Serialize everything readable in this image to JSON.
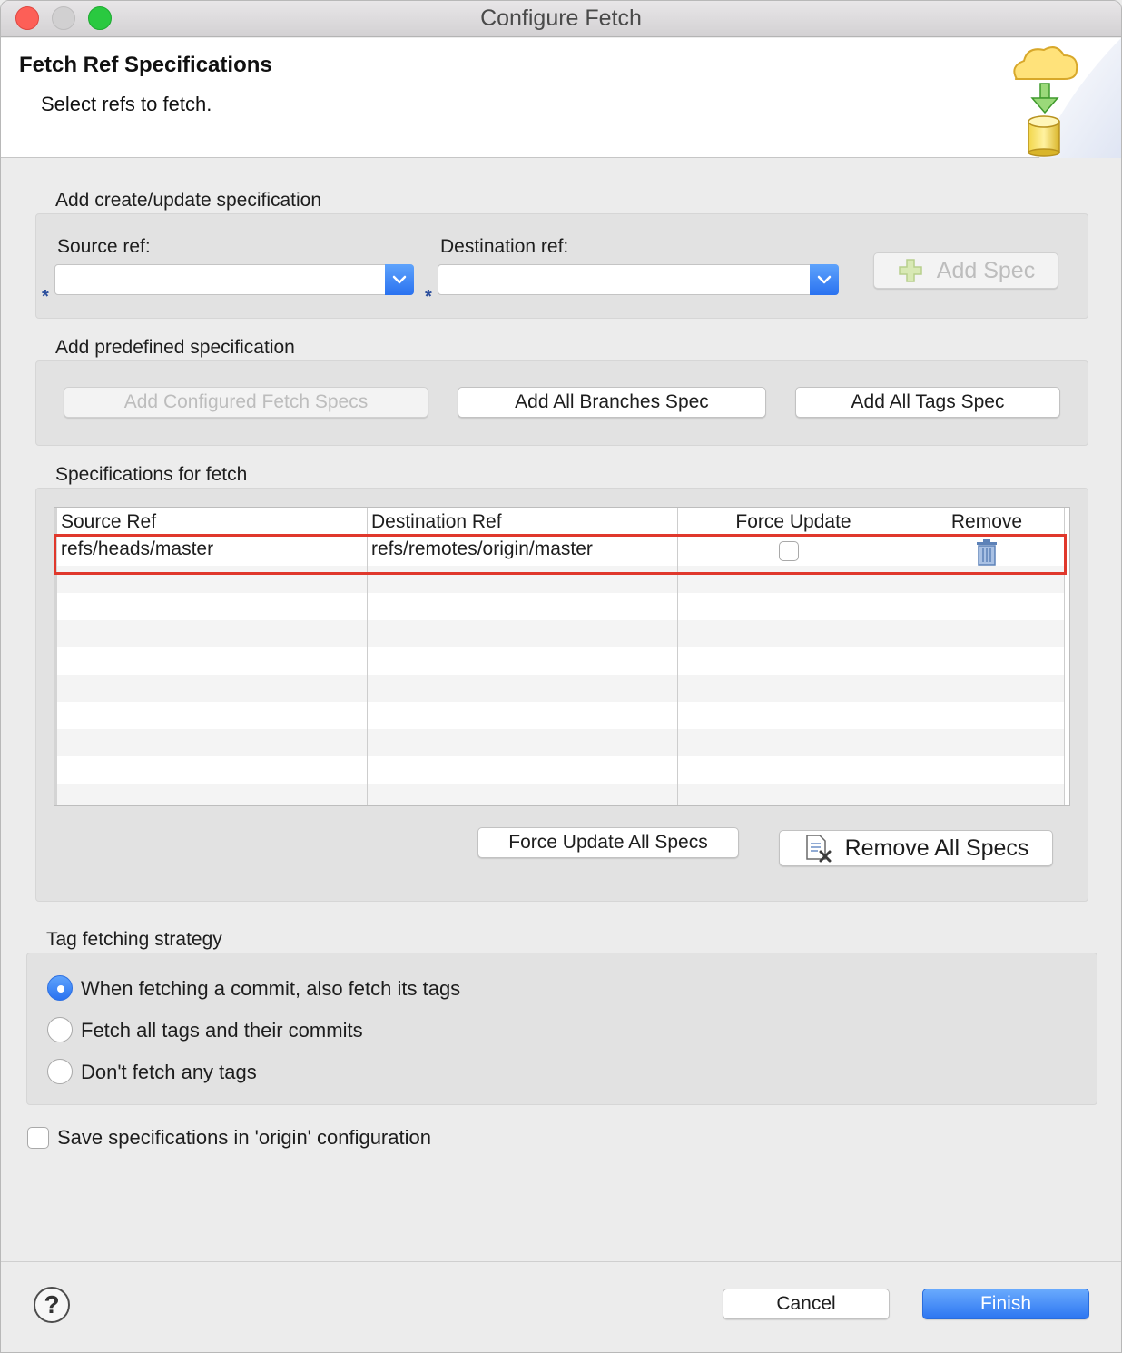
{
  "window": {
    "title": "Configure Fetch"
  },
  "banner": {
    "title": "Fetch Ref Specifications",
    "subtitle": "Select refs to fetch."
  },
  "create_update": {
    "group_label": "Add create/update specification",
    "source_label": "Source ref:",
    "source_value": "",
    "destination_label": "Destination ref:",
    "destination_value": "",
    "required_marker": "*",
    "add_spec_label": "Add Spec"
  },
  "predefined": {
    "group_label": "Add predefined specification",
    "add_configured_label": "Add Configured Fetch Specs",
    "add_all_branches_label": "Add All Branches Spec",
    "add_all_tags_label": "Add All Tags Spec"
  },
  "specs": {
    "group_label": "Specifications for fetch",
    "columns": [
      "Source Ref",
      "Destination Ref",
      "Force Update",
      "Remove"
    ],
    "rows": [
      {
        "source": "refs/heads/master",
        "destination": "refs/remotes/origin/master",
        "force_update": false
      }
    ],
    "force_update_all_label": "Force Update All Specs",
    "remove_all_label": "Remove All Specs"
  },
  "tags": {
    "group_label": "Tag fetching strategy",
    "options": [
      {
        "label": "When fetching a commit, also fetch its tags",
        "selected": true
      },
      {
        "label": "Fetch all tags and their commits",
        "selected": false
      },
      {
        "label": "Don't fetch any tags",
        "selected": false
      }
    ]
  },
  "save_config": {
    "label": "Save specifications in 'origin' configuration",
    "checked": false
  },
  "footer": {
    "help_glyph": "?",
    "cancel_label": "Cancel",
    "finish_label": "Finish"
  }
}
